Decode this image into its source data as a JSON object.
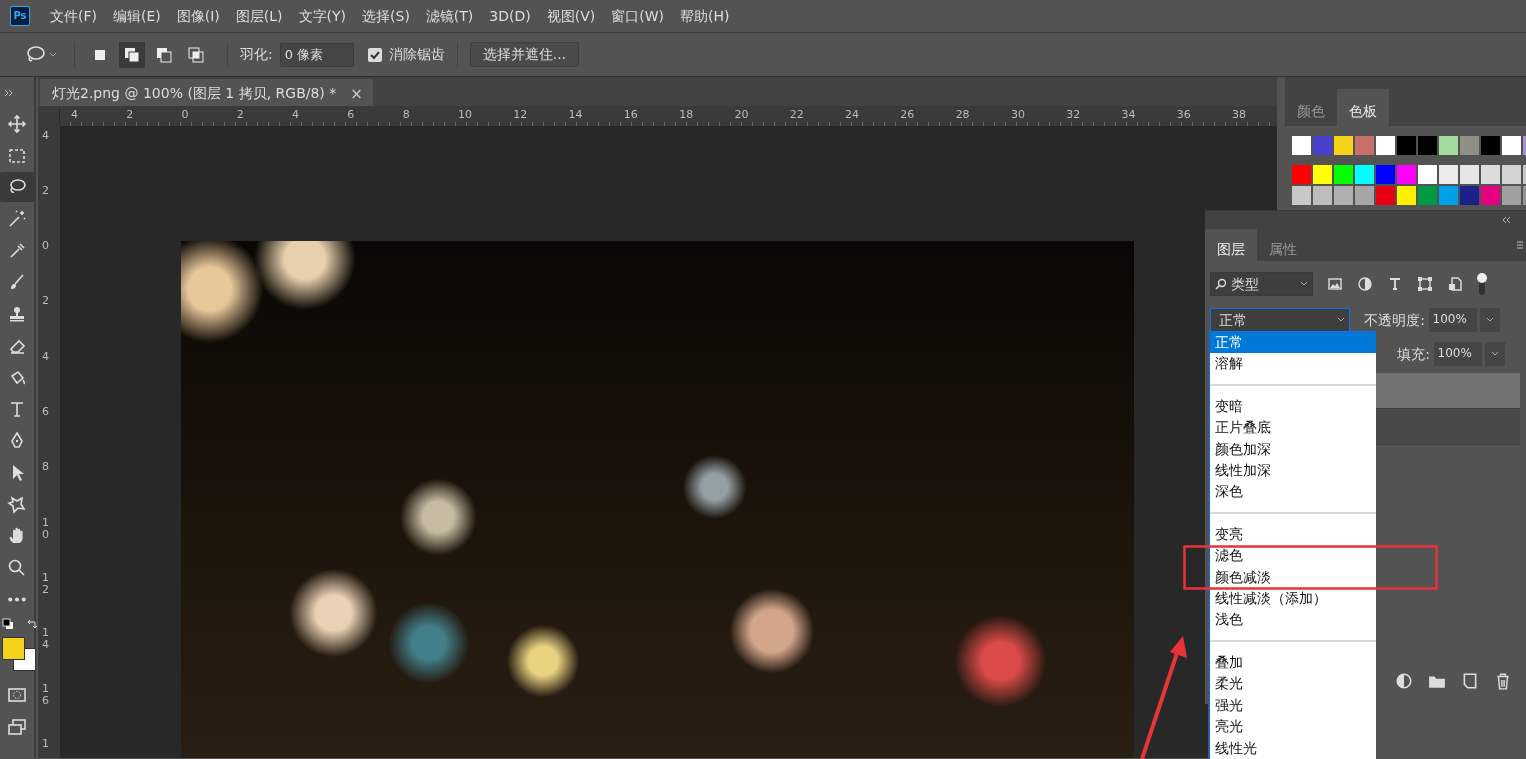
{
  "app": {
    "logo": "Ps"
  },
  "menu": [
    "文件(F)",
    "编辑(E)",
    "图像(I)",
    "图层(L)",
    "文字(Y)",
    "选择(S)",
    "滤镜(T)",
    "3D(D)",
    "视图(V)",
    "窗口(W)",
    "帮助(H)"
  ],
  "options_bar": {
    "selection_modes": [
      {
        "kind": "new",
        "selected": false
      },
      {
        "kind": "add",
        "selected": true
      },
      {
        "kind": "subtract",
        "selected": false
      },
      {
        "kind": "intersect",
        "selected": false
      }
    ],
    "feather_label": "羽化:",
    "feather_value": "0 像素",
    "anti_alias": {
      "label": "消除锯齿",
      "checked": true
    },
    "select_mask_button": "选择并遮住..."
  },
  "document_tab": {
    "title": "灯光2.png @ 100% (图层 1 拷贝, RGB/8) *",
    "close": "×"
  },
  "rulers": {
    "horizontal": [
      "4",
      "2",
      "0",
      "2",
      "4",
      "6",
      "8",
      "10",
      "12",
      "14",
      "16",
      "18",
      "20",
      "22",
      "24",
      "26",
      "28",
      "30",
      "32",
      "34",
      "36",
      "38"
    ],
    "vertical": [
      "4",
      "2",
      "0",
      "2",
      "4",
      "6",
      "8",
      "10",
      "12",
      "14",
      "16",
      "1"
    ]
  },
  "tools": [
    {
      "kind": "move",
      "selected": false
    },
    {
      "kind": "marquee",
      "selected": false
    },
    {
      "kind": "lasso",
      "selected": true
    },
    {
      "kind": "wand",
      "selected": false
    },
    {
      "kind": "eyedropper",
      "selected": false
    },
    {
      "kind": "brush",
      "selected": false
    },
    {
      "kind": "stamp",
      "selected": false
    },
    {
      "kind": "eraser",
      "selected": false
    },
    {
      "kind": "bucket",
      "selected": false
    },
    {
      "kind": "type",
      "selected": false
    },
    {
      "kind": "pen",
      "selected": false
    },
    {
      "kind": "path",
      "selected": false
    },
    {
      "kind": "shape",
      "selected": false
    },
    {
      "kind": "hand",
      "selected": false
    },
    {
      "kind": "zoom",
      "selected": false
    },
    {
      "kind": "more",
      "selected": false
    }
  ],
  "swatches_panel": {
    "tabs": [
      {
        "label": "颜色",
        "selected": false
      },
      {
        "label": "色板",
        "selected": true
      }
    ],
    "rows": [
      [
        {
          "color": "#ffffff"
        },
        {
          "color": "#4b3fcf"
        },
        {
          "color": "#f6d21b"
        },
        {
          "color": "#c76f6b"
        },
        {
          "color": "#ffffff"
        },
        {
          "color": "#000000"
        },
        {
          "color": "#000000"
        },
        {
          "color": "#a4dca0"
        },
        {
          "color": "#8f8f84"
        },
        {
          "color": "#000000"
        },
        {
          "color": "#ffffff"
        },
        {
          "color": "#a890d8"
        }
      ],
      [
        {
          "color": "#ff0000"
        },
        {
          "color": "#ffff00"
        },
        {
          "color": "#00ff00"
        },
        {
          "color": "#00ffff"
        },
        {
          "color": "#0000ff"
        },
        {
          "color": "#ff00ff"
        },
        {
          "color": "#ffffff"
        },
        {
          "color": "#ebebeb"
        },
        {
          "color": "#e6e6e6"
        },
        {
          "color": "#dcdcdc"
        },
        {
          "color": "#d2d2d2"
        },
        {
          "color": "#c8c8c8"
        }
      ],
      [
        {
          "color": "#c8c8c8"
        },
        {
          "color": "#bdbdbd"
        },
        {
          "color": "#b0b0b0"
        },
        {
          "color": "#a6a6a6"
        },
        {
          "color": "#e60012"
        },
        {
          "color": "#fff100"
        },
        {
          "color": "#009944"
        },
        {
          "color": "#00a0e9"
        },
        {
          "color": "#1d2088"
        },
        {
          "color": "#e4007f"
        },
        {
          "color": "#a0a0a0"
        },
        {
          "color": "#959595"
        }
      ]
    ]
  },
  "layers_panel": {
    "tabs": [
      {
        "label": "图层",
        "selected": true
      },
      {
        "label": "属性",
        "selected": false
      }
    ],
    "filter_label": "类型",
    "blend_mode": "正常",
    "opacity_label": "不透明度:",
    "opacity_value": "100%",
    "fill_label": "填充:",
    "fill_value": "100%",
    "layers": [
      {
        "selected": true
      },
      {
        "selected": false
      }
    ]
  },
  "blend_menu": {
    "groups": [
      [
        {
          "label": "正常",
          "selected": true
        },
        {
          "label": "溶解",
          "selected": false
        }
      ],
      [
        {
          "label": "变暗",
          "selected": false
        },
        {
          "label": "正片叠底",
          "selected": false
        },
        {
          "label": "颜色加深",
          "selected": false
        },
        {
          "label": "线性加深",
          "selected": false
        },
        {
          "label": "深色",
          "selected": false
        }
      ],
      [
        {
          "label": "变亮",
          "selected": false
        },
        {
          "label": "滤色",
          "selected": false
        },
        {
          "label": "颜色减淡",
          "selected": false
        },
        {
          "label": "线性减淡（添加）",
          "selected": false
        },
        {
          "label": "浅色",
          "selected": false
        }
      ],
      [
        {
          "label": "叠加",
          "selected": false
        },
        {
          "label": "柔光",
          "selected": false
        },
        {
          "label": "强光",
          "selected": false
        },
        {
          "label": "亮光",
          "selected": false
        },
        {
          "label": "线性光",
          "selected": false
        }
      ]
    ]
  }
}
